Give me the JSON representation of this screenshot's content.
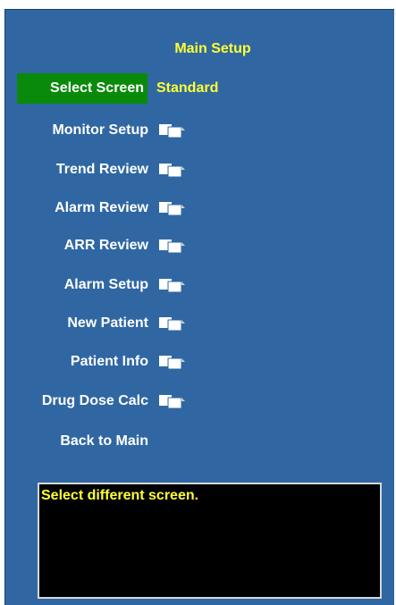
{
  "title": "Main Setup",
  "select_screen": {
    "label": "Select Screen",
    "value": "Standard"
  },
  "menu_items": [
    {
      "label": "Monitor Setup",
      "icon": "copy-pages-icon"
    },
    {
      "label": "Trend Review",
      "icon": "copy-pages-icon"
    },
    {
      "label": "Alarm Review",
      "icon": "copy-pages-icon"
    },
    {
      "label": "ARR Review",
      "icon": "copy-pages-icon"
    },
    {
      "label": "Alarm Setup",
      "icon": "copy-pages-icon"
    },
    {
      "label": "New Patient",
      "icon": "copy-pages-icon"
    },
    {
      "label": "Patient Info",
      "icon": "copy-pages-icon"
    },
    {
      "label": "Drug Dose Calc",
      "icon": "copy-pages-icon"
    }
  ],
  "back_label": "Back to Main",
  "message": "Select different screen.",
  "colors": {
    "panel": "#3067a3",
    "highlight": "#0a8a0a",
    "accent_text": "#ffff33",
    "message_bg": "#000000"
  }
}
